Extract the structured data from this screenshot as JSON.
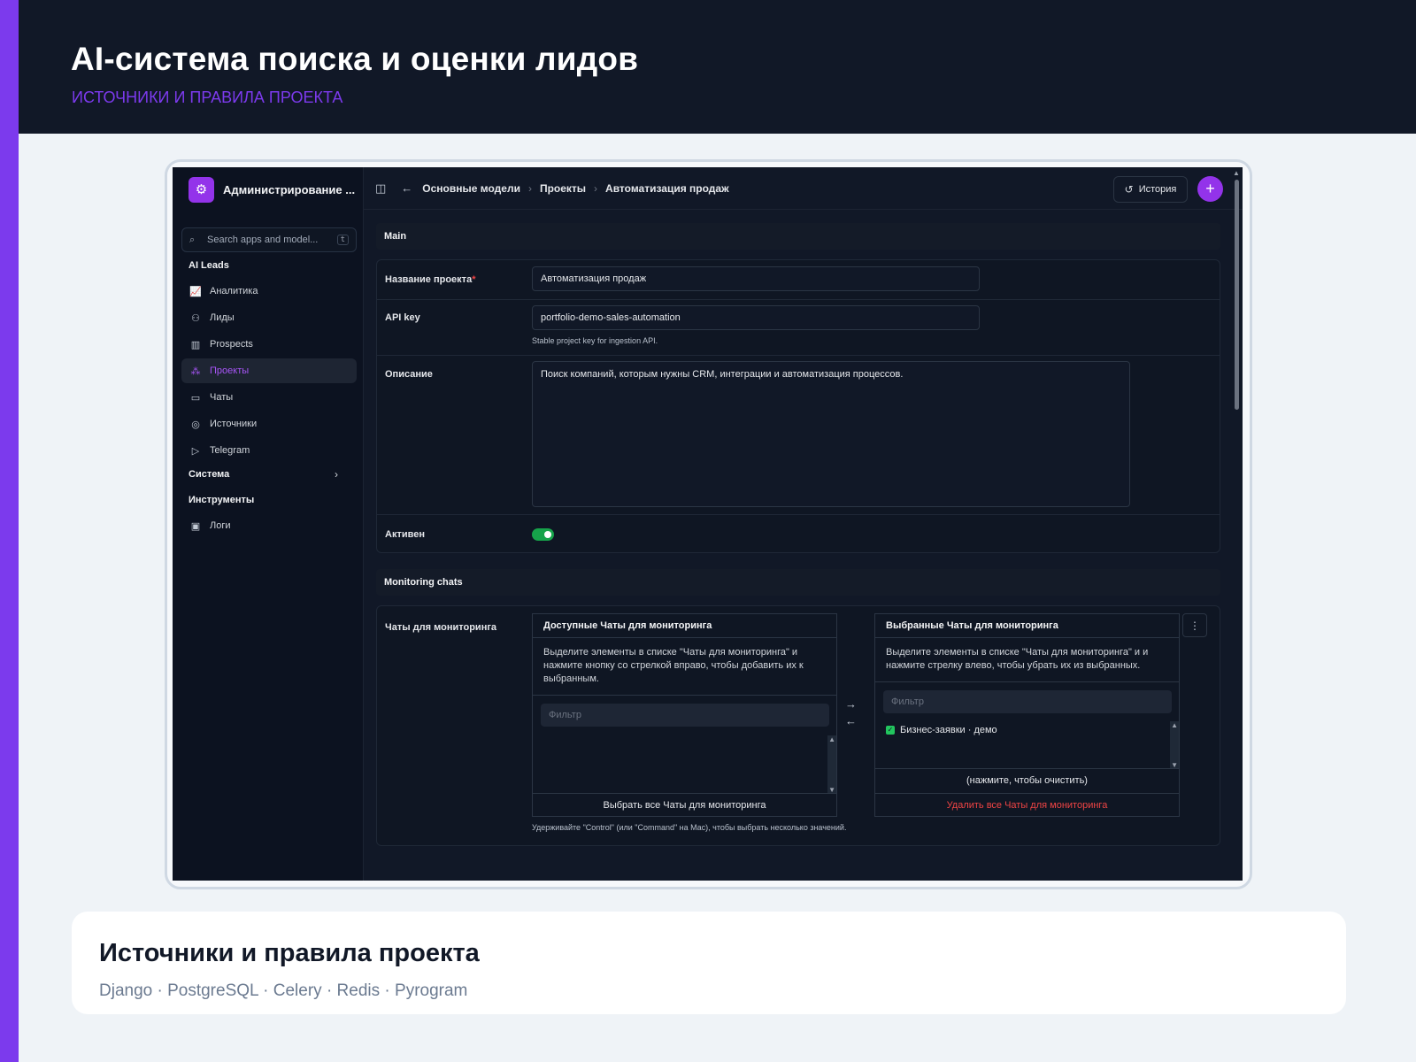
{
  "header": {
    "title": "AI-система поиска и оценки лидов",
    "subtitle": "ИСТОЧНИКИ И ПРАВИЛА ПРОЕКТА"
  },
  "colors": {
    "accent": "#7c3aed",
    "header_bg": "#111827",
    "toggle_on": "#16a34a",
    "danger": "#ef4444"
  },
  "admin": {
    "brand": {
      "name": "Администрирование ...",
      "icon": "gear-icon"
    },
    "search": {
      "placeholder": "Search apps and model...",
      "shortcut": "t"
    },
    "sidebar": {
      "group_ai": "AI Leads",
      "items": [
        {
          "label": "Аналитика",
          "icon": "chart-icon"
        },
        {
          "label": "Лиды",
          "icon": "users-icon"
        },
        {
          "label": "Prospects",
          "icon": "building-icon"
        },
        {
          "label": "Проекты",
          "icon": "hub-icon",
          "active": true
        },
        {
          "label": "Чаты",
          "icon": "chat-icon"
        },
        {
          "label": "Источники",
          "icon": "radar-icon"
        },
        {
          "label": "Telegram",
          "icon": "send-icon"
        }
      ],
      "group_system": "Система",
      "group_tools": "Инструменты",
      "tools_items": [
        {
          "label": "Логи",
          "icon": "terminal-icon"
        }
      ]
    },
    "breadcrumb": [
      "Основные модели",
      "Проекты",
      "Автоматизация продаж"
    ],
    "history_label": "История",
    "sections": {
      "main": "Main",
      "monitoring": "Monitoring chats"
    },
    "fields": {
      "name_label": "Название проекта",
      "name_required_mark": "*",
      "name_value": "Автоматизация продаж",
      "api_label": "API key",
      "api_value": "portfolio-demo-sales-automation",
      "api_help": "Stable project key for ingestion API.",
      "desc_label": "Описание",
      "desc_value": "Поиск компаний, которым нужны CRM, интеграции и автоматизация процессов.",
      "active_label": "Активен",
      "active_value": true
    },
    "monitoring": {
      "label": "Чаты для мониторинга",
      "available": {
        "title": "Доступные Чаты для мониторинга",
        "desc": "Выделите элементы в списке \"Чаты для мониторинга\" и нажмите кнопку со стрелкой вправо, чтобы добавить их к выбранным.",
        "filter_placeholder": "Фильтр",
        "footer": "Выбрать все Чаты для мониторинга"
      },
      "selected": {
        "title": "Выбранные Чаты для мониторинга",
        "desc": "Выделите элементы в списке \"Чаты для мониторинга\" и и нажмите стрелку влево, чтобы убрать их из выбранных.",
        "filter_placeholder": "Фильтр",
        "option": "Бизнес-заявки · демо",
        "clear": "(нажмите, чтобы очистить)",
        "footer": "Удалить все Чаты для мониторинга"
      },
      "help": "Удерживайте \"Control\" (или \"Command\" на Mac), чтобы выбрать несколько значений."
    }
  },
  "footer_card": {
    "title": "Источники и правила проекта",
    "stack": "Django · PostgreSQL · Celery · Redis · Pyrogram"
  }
}
